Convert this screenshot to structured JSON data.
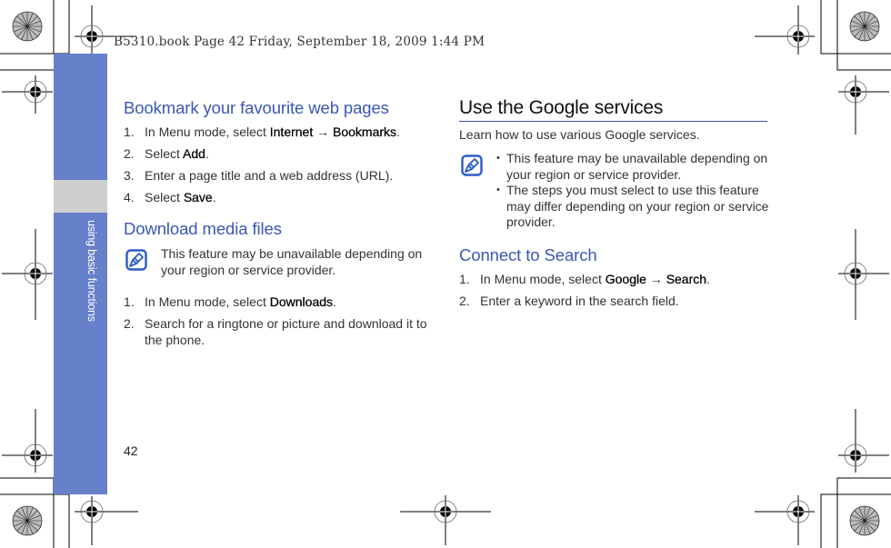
{
  "print_header": "B5310.book  Page 42  Friday, September 18, 2009  1:44 PM",
  "section_tab": "using basic functions",
  "page_number": "42",
  "colors": {
    "accent": "#3a57b5",
    "sidebar": "#6680c9",
    "sidebar_gray": "#cfcfcf"
  },
  "left_column": {
    "bookmark": {
      "title": "Bookmark your favourite web pages",
      "steps": [
        {
          "num": "1.",
          "parts": [
            "In Menu mode, select ",
            "Internet",
            " → ",
            "Bookmarks",
            "."
          ]
        },
        {
          "num": "2.",
          "parts": [
            "Select ",
            "Add",
            "."
          ]
        },
        {
          "num": "3.",
          "text": "Enter a page title and a web address (URL)."
        },
        {
          "num": "4.",
          "parts": [
            "Select ",
            "Save",
            "."
          ]
        }
      ]
    },
    "download": {
      "title": "Download media files",
      "note_icon": "note-pencil-icon",
      "note": "This feature may be unavailable depending on your region or service provider.",
      "steps": [
        {
          "num": "1.",
          "parts": [
            "In Menu mode, select ",
            "Downloads",
            "."
          ]
        },
        {
          "num": "2.",
          "text": "Search for a ringtone or picture and download it to the phone."
        }
      ]
    }
  },
  "right_column": {
    "google": {
      "title": "Use the Google services",
      "intro": "Learn how to use various Google services.",
      "note_icon": "note-pencil-icon",
      "notes": [
        "This feature may be unavailable depending on your region or service provider.",
        "The steps you must select to use this feature may differ depending on your region or service provider."
      ]
    },
    "search": {
      "title": "Connect to Search",
      "steps": [
        {
          "num": "1.",
          "parts": [
            "In Menu mode, select ",
            "Google",
            " → ",
            "Search",
            "."
          ]
        },
        {
          "num": "2.",
          "text": "Enter a keyword in the search field."
        }
      ]
    }
  }
}
